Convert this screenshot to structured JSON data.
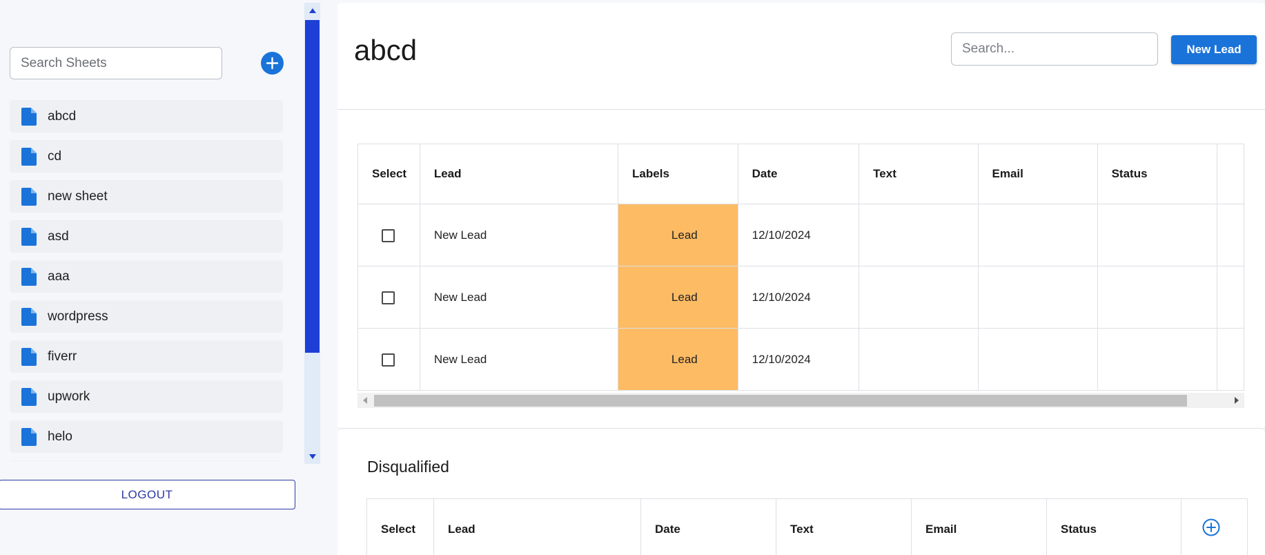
{
  "sidebar": {
    "search_placeholder": "Search Sheets",
    "sheets": [
      "abcd",
      "cd",
      "new sheet",
      "asd",
      "aaa",
      "wordpress",
      "fiverr",
      "upwork",
      "helo"
    ],
    "logout_label": "LOGOUT"
  },
  "main": {
    "title": "abcd",
    "search_placeholder": "Search...",
    "new_lead_label": "New Lead",
    "columns": [
      "Select",
      "Lead",
      "Labels",
      "Date",
      "Text",
      "Email",
      "Status"
    ],
    "rows": [
      {
        "lead": "New Lead",
        "label": "Lead",
        "date": "12/10/2024",
        "text": "",
        "email": "",
        "status": ""
      },
      {
        "lead": "New Lead",
        "label": "Lead",
        "date": "12/10/2024",
        "text": "",
        "email": "",
        "status": ""
      },
      {
        "lead": "New Lead",
        "label": "Lead",
        "date": "12/10/2024",
        "text": "",
        "email": "",
        "status": ""
      }
    ]
  },
  "disqualified": {
    "title": "Disqualified",
    "columns": [
      "Select",
      "Lead",
      "Date",
      "Text",
      "Email",
      "Status"
    ]
  },
  "colors": {
    "accent": "#1a73d9",
    "label_orange": "#fdbb64",
    "scroll_thumb": "#1d3fd6",
    "logout_text": "#2d3aa3"
  }
}
